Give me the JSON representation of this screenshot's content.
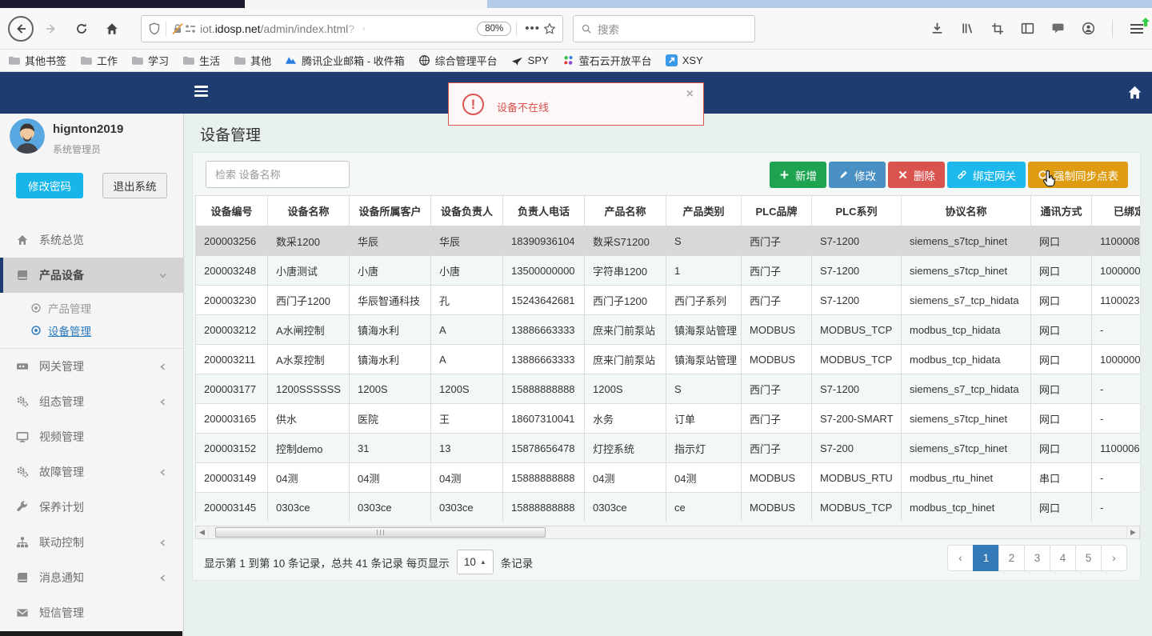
{
  "browser": {
    "url_prefix": "iot.",
    "url_domain": "idosp.net",
    "url_path": "/admin/index.html",
    "url_query": "?",
    "zoom_badge": "80%",
    "search_placeholder": "搜索",
    "bookmarks": [
      {
        "label": "其他书签",
        "icon": "folder"
      },
      {
        "label": "工作",
        "icon": "folder"
      },
      {
        "label": "学习",
        "icon": "folder"
      },
      {
        "label": "生活",
        "icon": "folder"
      },
      {
        "label": "其他",
        "icon": "folder"
      },
      {
        "label": "腾讯企业邮箱 - 收件箱",
        "icon": "tencent"
      },
      {
        "label": "综合管理平台",
        "icon": "globe"
      },
      {
        "label": "SPY",
        "icon": "spy"
      },
      {
        "label": "萤石云开放平台",
        "icon": "ys7"
      },
      {
        "label": "XSY",
        "icon": "xsy"
      }
    ]
  },
  "app": {
    "alert": {
      "message": "设备不在线"
    },
    "sidebar": {
      "user_name": "hignton2019",
      "user_role": "系统管理员",
      "change_password_label": "修改密码",
      "logout_label": "退出系统",
      "menu": [
        {
          "label": "系统总览",
          "icon": "home"
        },
        {
          "label": "产品设备",
          "icon": "book",
          "state": "expanded",
          "active": true,
          "children": [
            {
              "label": "产品管理",
              "active": false
            },
            {
              "label": "设备管理",
              "active": true
            }
          ]
        },
        {
          "label": "网关管理",
          "icon": "gateway",
          "state": "collapsed"
        },
        {
          "label": "组态管理",
          "icon": "gears",
          "state": "collapsed"
        },
        {
          "label": "视频管理",
          "icon": "monitor"
        },
        {
          "label": "故障管理",
          "icon": "gears",
          "state": "collapsed"
        },
        {
          "label": "保养计划",
          "icon": "wrench"
        },
        {
          "label": "联动控制",
          "icon": "sitemap",
          "state": "collapsed"
        },
        {
          "label": "消息通知",
          "icon": "book",
          "state": "collapsed"
        },
        {
          "label": "短信管理",
          "icon": "envelope"
        }
      ]
    },
    "page_title": "设备管理",
    "toolbar": {
      "search_placeholder": "检索 设备名称",
      "buttons": [
        {
          "name": "add",
          "label": "新增",
          "icon": "plus",
          "color": "#1ea351"
        },
        {
          "name": "edit",
          "label": "修改",
          "icon": "pencil",
          "color": "#4a90c4"
        },
        {
          "name": "delete",
          "label": "删除",
          "icon": "cross",
          "color": "#d9534f"
        },
        {
          "name": "bind-gateway",
          "label": "绑定网关",
          "icon": "link",
          "color": "#1db9ec"
        },
        {
          "name": "force-sync",
          "label": "强制同步点表",
          "icon": "refresh",
          "color": "#df9c13"
        }
      ]
    },
    "table": {
      "columns": [
        "设备编号",
        "设备名称",
        "设备所属客户",
        "设备负责人",
        "负责人电话",
        "产品名称",
        "产品类别",
        "PLC品牌",
        "PLC系列",
        "协议名称",
        "通讯方式",
        "已绑定网关"
      ],
      "selected_row_index": 0,
      "rows": [
        [
          "200003256",
          "数采1200",
          "华辰",
          "华辰",
          "18390936104",
          "数采S71200",
          "S",
          "西门子",
          "S7-1200",
          "siemens_s7tcp_hinet",
          "网口",
          "1100008"
        ],
        [
          "200003248",
          "小唐测试",
          "小唐",
          "小唐",
          "13500000000",
          "字符串1200",
          "1",
          "西门子",
          "S7-1200",
          "siemens_s7tcp_hinet",
          "网口",
          "1000000"
        ],
        [
          "200003230",
          "西门子1200",
          "华辰智通科技",
          "孔",
          "15243642681",
          "西门子1200",
          "西门子系列",
          "西门子",
          "S7-1200",
          "siemens_s7_tcp_hidata",
          "网口",
          "1100023"
        ],
        [
          "200003212",
          "A水闸控制",
          "镇海水利",
          "A",
          "13886663333",
          "庶来门前泵站",
          "镇海泵站管理",
          "MODBUS",
          "MODBUS_TCP",
          "modbus_tcp_hidata",
          "网口",
          "-"
        ],
        [
          "200003211",
          "A水泵控制",
          "镇海水利",
          "A",
          "13886663333",
          "庶来门前泵站",
          "镇海泵站管理",
          "MODBUS",
          "MODBUS_TCP",
          "modbus_tcp_hidata",
          "网口",
          "1000000"
        ],
        [
          "200003177",
          "1200SSSSSS",
          "1200S",
          "1200S",
          "15888888888",
          "1200S",
          "S",
          "西门子",
          "S7-1200",
          "siemens_s7_tcp_hidata",
          "网口",
          "-"
        ],
        [
          "200003165",
          "供水",
          "医院",
          "王",
          "18607310041",
          "水务",
          "订单",
          "西门子",
          "S7-200-SMART",
          "siemens_s7tcp_hinet",
          "网口",
          "-"
        ],
        [
          "200003152",
          "控制demo",
          "31",
          "13",
          "15878656478",
          "灯控系统",
          "指示灯",
          "西门子",
          "S7-200",
          "siemens_s7tcp_hinet",
          "网口",
          "1100006"
        ],
        [
          "200003149",
          "04测",
          "04测",
          "04测",
          "15888888888",
          "04测",
          "04测",
          "MODBUS",
          "MODBUS_RTU",
          "modbus_rtu_hinet",
          "串口",
          "-"
        ],
        [
          "200003145",
          "0303ce",
          "0303ce",
          "0303ce",
          "15888888888",
          "0303ce",
          "ce",
          "MODBUS",
          "MODBUS_TCP",
          "modbus_tcp_hinet",
          "网口",
          "-"
        ]
      ]
    },
    "pagination": {
      "summary_prefix": "显示第 1 到第 10 条记录，总共 41 条记录 每页显示",
      "page_size": "10",
      "summary_suffix": "条记录",
      "pages": [
        "1",
        "2",
        "3",
        "4",
        "5"
      ],
      "active_page": "1"
    },
    "colors": {
      "navbar": "#1e3c6f",
      "active_link": "#2b7abf",
      "pagination_active": "#337ab7",
      "alert_red": "#d9534f",
      "primary_cyan": "#17b6ea"
    }
  }
}
